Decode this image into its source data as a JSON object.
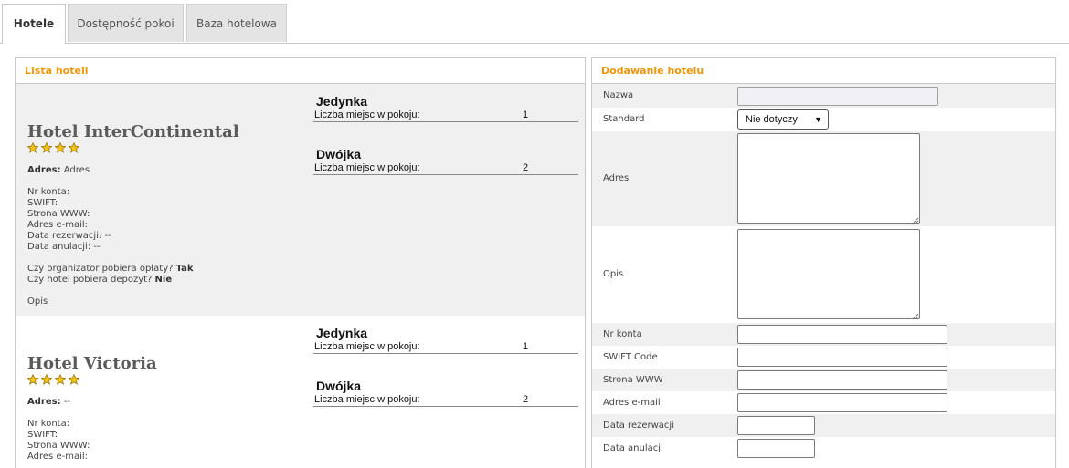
{
  "tabs": [
    {
      "label": "Hotele",
      "active": true
    },
    {
      "label": "Dostępność pokoi",
      "active": false
    },
    {
      "label": "Baza hotelowa",
      "active": false
    }
  ],
  "left_panel": {
    "title": "Lista hoteli",
    "hotels": [
      {
        "name": "Hotel InterContinental",
        "stars": 4,
        "address_label": "Adres",
        "address_value": "Adres",
        "account_label": "Nr konta:",
        "swift_label": "SWIFT:",
        "www_label": "Strona WWW:",
        "email_label": "Adres e-mail:",
        "reservation_label": "Data rezerwacji:",
        "reservation_value": "--",
        "cancel_label": "Data anulacji:",
        "cancel_value": "--",
        "fee_question": "Czy organizator pobiera opłaty?",
        "fee_answer": "Tak",
        "deposit_question": "Czy hotel pobiera depozyt?",
        "deposit_answer": "Nie",
        "description_label": "Opis",
        "rooms": [
          {
            "name": "Jedynka",
            "capacity_label": "Liczba miejsc w pokoju:",
            "capacity": "1"
          },
          {
            "name": "Dwójka",
            "capacity_label": "Liczba miejsc w pokoju:",
            "capacity": "2"
          }
        ]
      },
      {
        "name": "Hotel Victoria",
        "stars": 4,
        "address_label": "Adres",
        "address_value": "--",
        "account_label": "Nr konta:",
        "swift_label": "SWIFT:",
        "www_label": "Strona WWW:",
        "email_label": "Adres e-mail:",
        "rooms": [
          {
            "name": "Jedynka",
            "capacity_label": "Liczba miejsc w pokoju:",
            "capacity": "1"
          },
          {
            "name": "Dwójka",
            "capacity_label": "Liczba miejsc w pokoju:",
            "capacity": "2"
          }
        ]
      }
    ]
  },
  "right_panel": {
    "title": "Dodawanie hotelu",
    "fields": {
      "name": {
        "label": "Nazwa",
        "value": ""
      },
      "standard": {
        "label": "Standard",
        "value": "Nie dotyczy"
      },
      "address": {
        "label": "Adres",
        "value": ""
      },
      "description": {
        "label": "Opis",
        "value": ""
      },
      "account": {
        "label": "Nr konta",
        "value": ""
      },
      "swift": {
        "label": "SWIFT Code",
        "value": ""
      },
      "www": {
        "label": "Strona WWW",
        "value": ""
      },
      "email": {
        "label": "Adres e-mail",
        "value": ""
      },
      "reservation_date": {
        "label": "Data rezerwacji",
        "value": ""
      },
      "cancel_date": {
        "label": "Data anulacji",
        "value": ""
      }
    }
  },
  "colors": {
    "accent": "#f0960a",
    "star": "#f2c21b",
    "row_alt": "#f0f0f0"
  },
  "icons": {
    "rating": "star-icon",
    "select": "chevron-down-icon",
    "resize": "resize-grip-icon"
  }
}
